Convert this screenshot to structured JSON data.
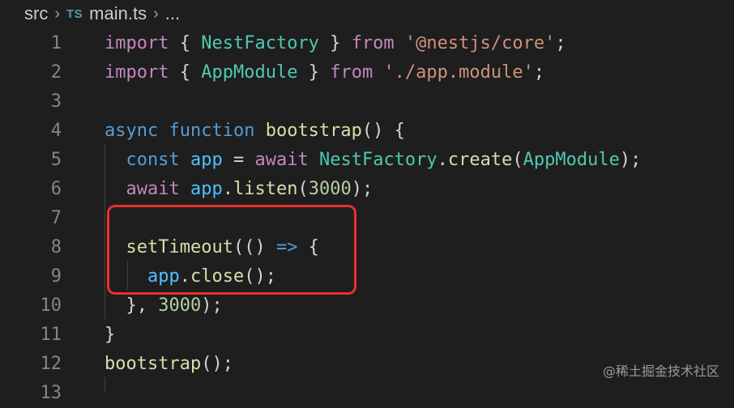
{
  "breadcrumb": {
    "folder": "src",
    "file_icon": "TS",
    "file": "main.ts",
    "ellipsis": "..."
  },
  "lines": [
    {
      "n": "1",
      "tokens": [
        [
          "import",
          "kw"
        ],
        [
          " { ",
          "p"
        ],
        [
          "NestFactory",
          "cls"
        ],
        [
          " } ",
          "p"
        ],
        [
          "from",
          "kw"
        ],
        [
          " ",
          "p"
        ],
        [
          "'@nestjs/core'",
          "str"
        ],
        [
          ";",
          "p"
        ]
      ]
    },
    {
      "n": "2",
      "tokens": [
        [
          "import",
          "kw"
        ],
        [
          " { ",
          "p"
        ],
        [
          "AppModule",
          "cls"
        ],
        [
          " } ",
          "p"
        ],
        [
          "from",
          "kw"
        ],
        [
          " ",
          "p"
        ],
        [
          "'./app.module'",
          "str"
        ],
        [
          ";",
          "p"
        ]
      ]
    },
    {
      "n": "3",
      "tokens": []
    },
    {
      "n": "4",
      "tokens": [
        [
          "async",
          "kwb"
        ],
        [
          " ",
          "p"
        ],
        [
          "function",
          "kwb"
        ],
        [
          " ",
          "p"
        ],
        [
          "bootstrap",
          "fn"
        ],
        [
          "() {",
          "p"
        ]
      ]
    },
    {
      "n": "5",
      "tokens": [
        [
          "  ",
          "p"
        ],
        [
          "const",
          "kwb"
        ],
        [
          " ",
          "p"
        ],
        [
          "app",
          "cst"
        ],
        [
          " = ",
          "p"
        ],
        [
          "await",
          "kw"
        ],
        [
          " ",
          "p"
        ],
        [
          "NestFactory",
          "cls"
        ],
        [
          ".",
          "p"
        ],
        [
          "create",
          "fn"
        ],
        [
          "(",
          "p"
        ],
        [
          "AppModule",
          "cls"
        ],
        [
          ");",
          "p"
        ]
      ]
    },
    {
      "n": "6",
      "tokens": [
        [
          "  ",
          "p"
        ],
        [
          "await",
          "kw"
        ],
        [
          " ",
          "p"
        ],
        [
          "app",
          "cst"
        ],
        [
          ".",
          "p"
        ],
        [
          "listen",
          "fn"
        ],
        [
          "(",
          "p"
        ],
        [
          "3000",
          "num"
        ],
        [
          ");",
          "p"
        ]
      ]
    },
    {
      "n": "7",
      "tokens": []
    },
    {
      "n": "8",
      "tokens": [
        [
          "  ",
          "p"
        ],
        [
          "setTimeout",
          "fn"
        ],
        [
          "(() ",
          "p"
        ],
        [
          "=>",
          "kwb"
        ],
        [
          " {",
          "p"
        ]
      ]
    },
    {
      "n": "9",
      "tokens": [
        [
          "    ",
          "p"
        ],
        [
          "app",
          "cst"
        ],
        [
          ".",
          "p"
        ],
        [
          "close",
          "fn"
        ],
        [
          "();",
          "p"
        ]
      ]
    },
    {
      "n": "10",
      "tokens": [
        [
          "  }, ",
          "p"
        ],
        [
          "3000",
          "num"
        ],
        [
          ");",
          "p"
        ]
      ]
    },
    {
      "n": "11",
      "tokens": [
        [
          "}",
          "p"
        ]
      ]
    },
    {
      "n": "12",
      "tokens": [
        [
          "bootstrap",
          "fn"
        ],
        [
          "();",
          "p"
        ]
      ]
    },
    {
      "n": "13",
      "tokens": []
    }
  ],
  "watermark": "@稀土掘金技术社区",
  "colors": {
    "background": "#1e1e1e",
    "highlight_border": "#e8322a"
  }
}
